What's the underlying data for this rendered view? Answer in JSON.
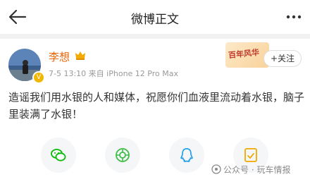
{
  "header": {
    "title": "微博正文",
    "back_icon": "back-arrow-icon",
    "more_icon": "more-dots-icon"
  },
  "post": {
    "author": {
      "name": "李想",
      "badge_icon": "crown-icon",
      "verified_icon": "verified-badge-icon"
    },
    "time": "7-5 13:10",
    "source_prefix": "来自",
    "device": "iPhone 12 Pro Max",
    "promo_text": "百年风华",
    "follow_label": "+关注",
    "content": "造谣我们用水银的人和媒体，祝愿你们血液里流动着水银，脑子里装满了水银！"
  },
  "share": [
    {
      "icon": "wechat-icon",
      "color": "#09bb07"
    },
    {
      "icon": "moments-icon",
      "color": "#3dbe44"
    },
    {
      "icon": "qq-icon",
      "color": "#20a0e8"
    },
    {
      "icon": "save-image-icon",
      "color": "#f2a900"
    }
  ],
  "watermark": {
    "text": "公众号 · 玩车情报"
  },
  "colors": {
    "name": "#e8650a",
    "meta": "#999999",
    "divider": "#f2f2f2",
    "share_bg": "#f5f6f8"
  }
}
